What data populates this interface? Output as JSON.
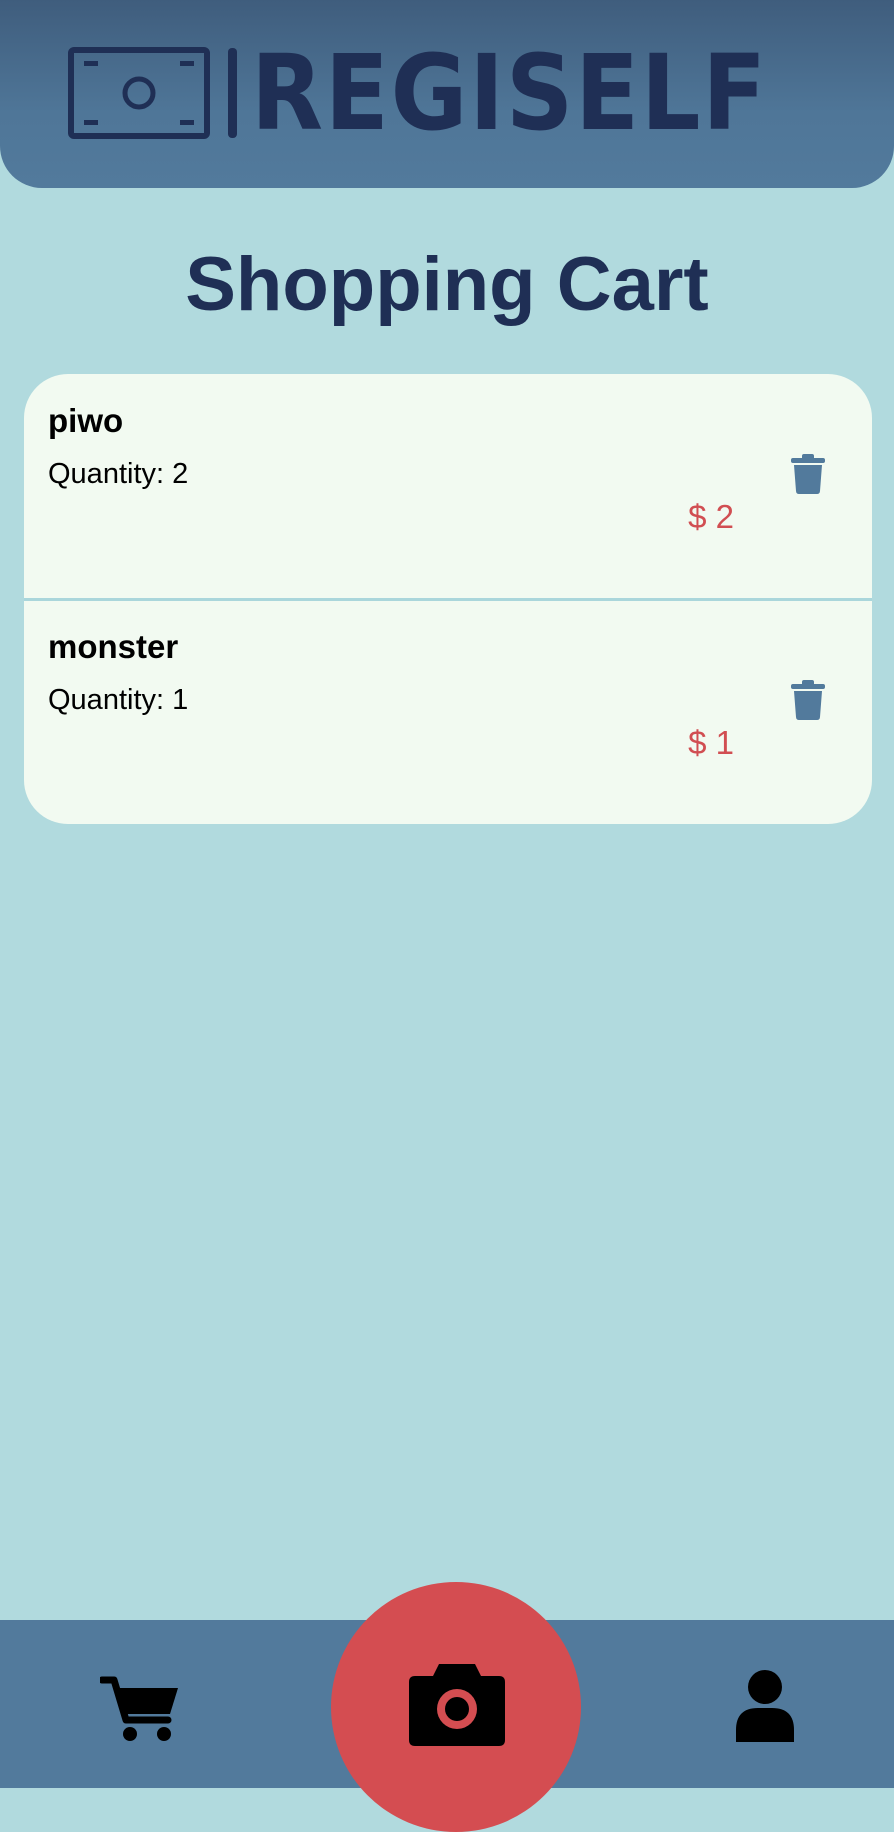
{
  "app": {
    "name": "REGISELF"
  },
  "page": {
    "title": "Shopping Cart"
  },
  "cart": {
    "items": [
      {
        "name": "piwo",
        "quantity_text": "Quantity: 2",
        "price_text": "$ 2"
      },
      {
        "name": "monster",
        "quantity_text": "Quantity: 1",
        "price_text": "$ 1"
      }
    ]
  },
  "icons": {
    "logo": "banknote-icon",
    "delete": "trash-icon",
    "nav_cart": "shopping-cart-icon",
    "nav_camera": "camera-icon",
    "nav_profile": "user-icon"
  },
  "colors": {
    "background": "#b1dade",
    "header": "#527a9c",
    "brand_dark": "#1f2f55",
    "card": "#f2faf1",
    "price": "#d14e52",
    "accent_button": "#d44d51",
    "trash": "#527a9c"
  }
}
